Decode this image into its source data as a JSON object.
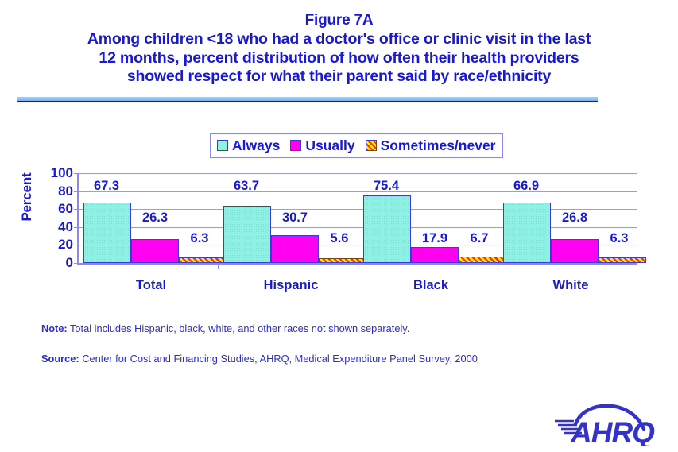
{
  "title": {
    "figure": "Figure 7A",
    "line1": "Among children <18 who had a doctor's office or clinic visit in the last",
    "line2": "12 months, percent distribution of how often their health providers",
    "line3": "showed respect for what their parent said by race/ethnicity"
  },
  "legend": {
    "items": [
      {
        "label": "Always",
        "swatch": "light-cyan-square",
        "color": "#8ff0e4"
      },
      {
        "label": "Usually",
        "swatch": "magenta-square",
        "color": "#ff00f0"
      },
      {
        "label": "Sometimes/never",
        "swatch": "yellow-red-diagonal-stripe-square",
        "color": "#ffec00"
      }
    ]
  },
  "axis": {
    "ylabel": "Percent",
    "yticks": [
      "100",
      "80",
      "60",
      "40",
      "20",
      "0"
    ]
  },
  "footer": {
    "note_label": "Note:",
    "note_text": " Total includes Hispanic, black, white, and other races not shown separately.",
    "source_label": "Source:",
    "source_text": " Center for Cost and Financing Studies, AHRQ, Medical Expenditure Panel Survey, 2000"
  },
  "logo": {
    "text": "AHRQ",
    "color": "#3333cc"
  },
  "chart_data": {
    "type": "bar",
    "title": "Figure 7A - Among children <18 who had a doctor's office or clinic visit in the last 12 months, percent distribution of how often their health providers showed respect for what their parent said by race/ethnicity",
    "xlabel": "",
    "ylabel": "Percent",
    "ylim": [
      0,
      100
    ],
    "yticks": [
      0,
      20,
      40,
      60,
      80,
      100
    ],
    "grid": true,
    "legend_position": "top-center",
    "categories": [
      "Total",
      "Hispanic",
      "Black",
      "White"
    ],
    "series": [
      {
        "name": "Always",
        "color": "#8ff0e4",
        "values": [
          67.3,
          63.7,
          75.4,
          66.9
        ]
      },
      {
        "name": "Usually",
        "color": "#ff00f0",
        "values": [
          26.3,
          30.7,
          17.9,
          26.8
        ]
      },
      {
        "name": "Sometimes/never",
        "color": "#ffec00",
        "values": [
          6.3,
          5.6,
          6.7,
          6.3
        ]
      }
    ],
    "data_labels": [
      [
        "67.3",
        "26.3",
        "6.3"
      ],
      [
        "63.7",
        "30.7",
        "5.6"
      ],
      [
        "75.4",
        "17.9",
        "6.7"
      ],
      [
        "66.9",
        "26.8",
        "6.3"
      ]
    ]
  }
}
